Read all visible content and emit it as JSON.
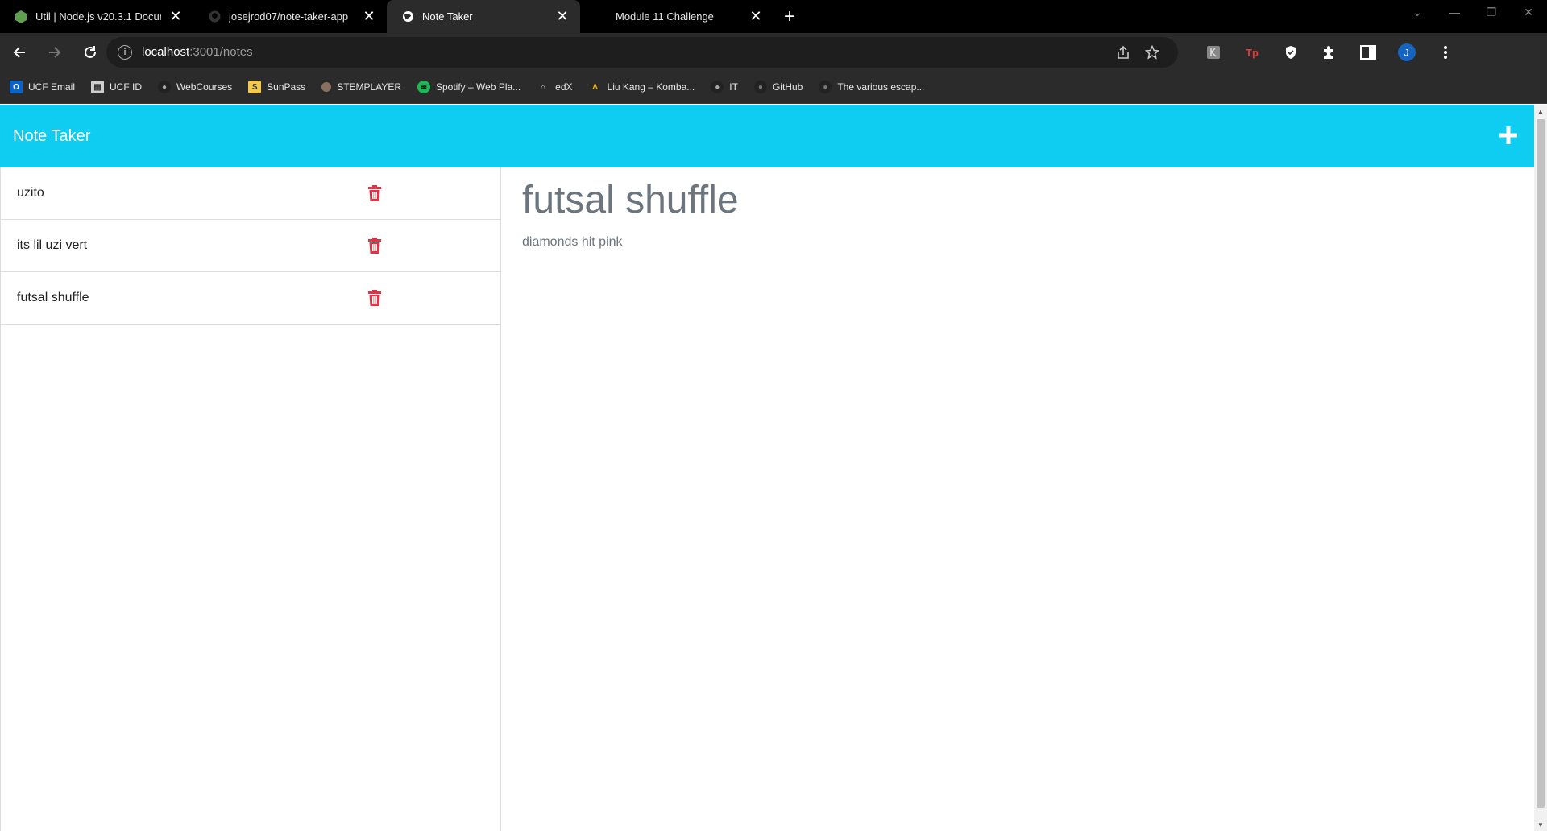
{
  "browser": {
    "tabs": [
      {
        "title": "Util | Node.js v20.3.1 Documen",
        "icon": "nodejs-icon",
        "active": false
      },
      {
        "title": "josejrod07/note-taker-app",
        "icon": "github-icon",
        "active": false
      },
      {
        "title": "Note Taker",
        "icon": "globe-icon",
        "active": true
      },
      {
        "title": "Module 11 Challenge",
        "icon": "",
        "active": false
      }
    ],
    "url": {
      "host": "localhost",
      "path": ":3001/notes"
    },
    "bookmarks": [
      {
        "label": "UCF Email",
        "icon": "outlook-icon",
        "color": "#0a64c8"
      },
      {
        "label": "UCF ID",
        "icon": "id-card-icon",
        "color": "#cfcfcf"
      },
      {
        "label": "WebCourses",
        "icon": "canvas-icon",
        "color": "#222222"
      },
      {
        "label": "SunPass",
        "icon": "sunpass-icon",
        "color": "#f2c94c"
      },
      {
        "label": "STEMPLAYER",
        "icon": "stemplayer-icon",
        "color": "#8a7060"
      },
      {
        "label": "Spotify – Web Pla...",
        "icon": "spotify-icon",
        "color": "#1db954"
      },
      {
        "label": "edX",
        "icon": "edx-icon",
        "color": "#dddddd"
      },
      {
        "label": "Liu Kang – Komba...",
        "icon": "fandom-icon",
        "color": "#f5b400"
      },
      {
        "label": "IT",
        "icon": "it-icon",
        "color": "#222222"
      },
      {
        "label": "GitHub",
        "icon": "github-icon",
        "color": "#222222"
      },
      {
        "label": "The various escap...",
        "icon": "github-icon",
        "color": "#222222"
      }
    ]
  },
  "app": {
    "title": "Note Taker",
    "accent": "#0ecdf1",
    "notes": [
      {
        "title": "uzito"
      },
      {
        "title": "its lil uzi vert"
      },
      {
        "title": "futsal shuffle"
      }
    ],
    "active_note": {
      "title": "futsal shuffle",
      "text": "diamonds hit pink"
    }
  }
}
